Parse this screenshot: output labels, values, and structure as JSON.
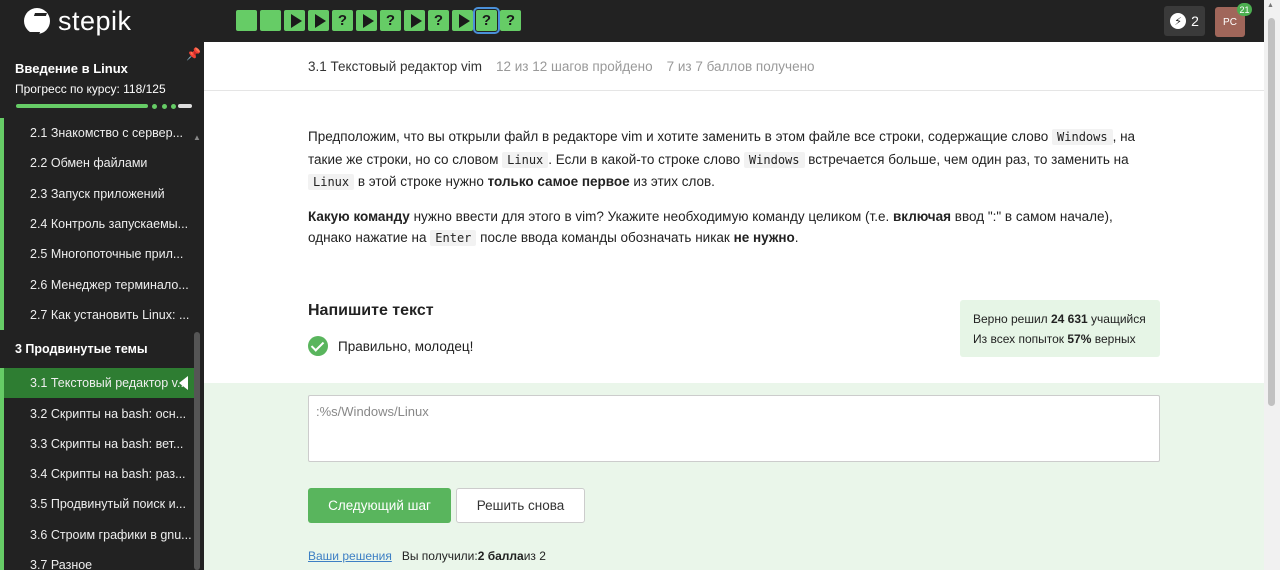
{
  "brand": {
    "name": "stepik"
  },
  "steps": [
    {
      "type": "plain"
    },
    {
      "type": "plain"
    },
    {
      "type": "video"
    },
    {
      "type": "video"
    },
    {
      "type": "question",
      "label": "?"
    },
    {
      "type": "video"
    },
    {
      "type": "question",
      "label": "?"
    },
    {
      "type": "video"
    },
    {
      "type": "question",
      "label": "?"
    },
    {
      "type": "video"
    },
    {
      "type": "question",
      "label": "?",
      "active": true
    },
    {
      "type": "question",
      "label": "?"
    }
  ],
  "topbar": {
    "streak": "2",
    "avatar_initials": "PC",
    "notifications": "21"
  },
  "sidebar": {
    "course_title": "Введение в Linux",
    "progress_label": "Прогресс по курсу:",
    "progress_value": "118/125",
    "progress_fraction": 0.944,
    "items": [
      {
        "kind": "lesson",
        "label": "2.1  Знакомство с сервер..."
      },
      {
        "kind": "lesson",
        "label": "2.2  Обмен файлами"
      },
      {
        "kind": "lesson",
        "label": "2.3  Запуск приложений"
      },
      {
        "kind": "lesson",
        "label": "2.4  Контроль запускаемы..."
      },
      {
        "kind": "lesson",
        "label": "2.5  Многопоточные прил..."
      },
      {
        "kind": "lesson",
        "label": "2.6  Менеджер терминало..."
      },
      {
        "kind": "lesson",
        "label": "2.7  Как установить Linux: ..."
      },
      {
        "kind": "section",
        "label": "3  Продвинутые темы"
      },
      {
        "kind": "lesson",
        "label": "3.1  Текстовый редактор v...",
        "active": true
      },
      {
        "kind": "lesson",
        "label": "3.2  Скрипты на bash: осн..."
      },
      {
        "kind": "lesson",
        "label": "3.3  Скрипты на bash: вет..."
      },
      {
        "kind": "lesson",
        "label": "3.4  Скрипты на bash: раз..."
      },
      {
        "kind": "lesson",
        "label": "3.5  Продвинутый поиск и..."
      },
      {
        "kind": "lesson",
        "label": "3.6  Строим графики в gnu..."
      },
      {
        "kind": "lesson",
        "label": "3.7  Разное"
      }
    ]
  },
  "header": {
    "lesson_title": "3.1 Текстовый редактор vim",
    "steps_done": "12 из 12 шагов пройдено",
    "points": "7 из 7 баллов  получено"
  },
  "task": {
    "p1_a": "Предположим, что вы открыли файл в редакторе vim и хотите заменить в этом файле все строки, содержащие слово ",
    "code_windows": "Windows",
    "p1_b": ", на такие же строки, но со словом ",
    "code_linux": "Linux",
    "p1_c": ". Если в какой-то строке слово ",
    "p1_d": " встречается больше, чем один раз, то заменить на ",
    "p1_e": " в этой строке нужно ",
    "p1_bold": "только самое первое",
    "p1_f": " из этих слов.",
    "p2_bold1": "Какую команду",
    "p2_a": " нужно ввести для этого в vim? Укажите необходимую команду целиком (т.е. ",
    "p2_bold2": "включая",
    "p2_b": " ввод \":\" в самом начале), однако нажатие на ",
    "code_enter": "Enter",
    "p2_c": " после ввода команды обозначать никак ",
    "p2_bold3": "не нужно",
    "p2_d": "."
  },
  "answer_section": {
    "title": "Напишите текст",
    "correct_message": "Правильно, молодец!",
    "stats_line1_a": "Верно решил ",
    "stats_line1_num": "24 631",
    "stats_line1_b": " учащийся",
    "stats_line2_a": "Из всех попыток ",
    "stats_line2_num": "57%",
    "stats_line2_b": " верных",
    "answer_text": ":%s/Windows/Linux",
    "next_button": "Следующий шаг",
    "retry_button": "Решить снова",
    "solutions_link": "Ваши решения",
    "score_prefix": "Вы получили: ",
    "score_value": "2 балла",
    "score_suffix": " из 2"
  }
}
